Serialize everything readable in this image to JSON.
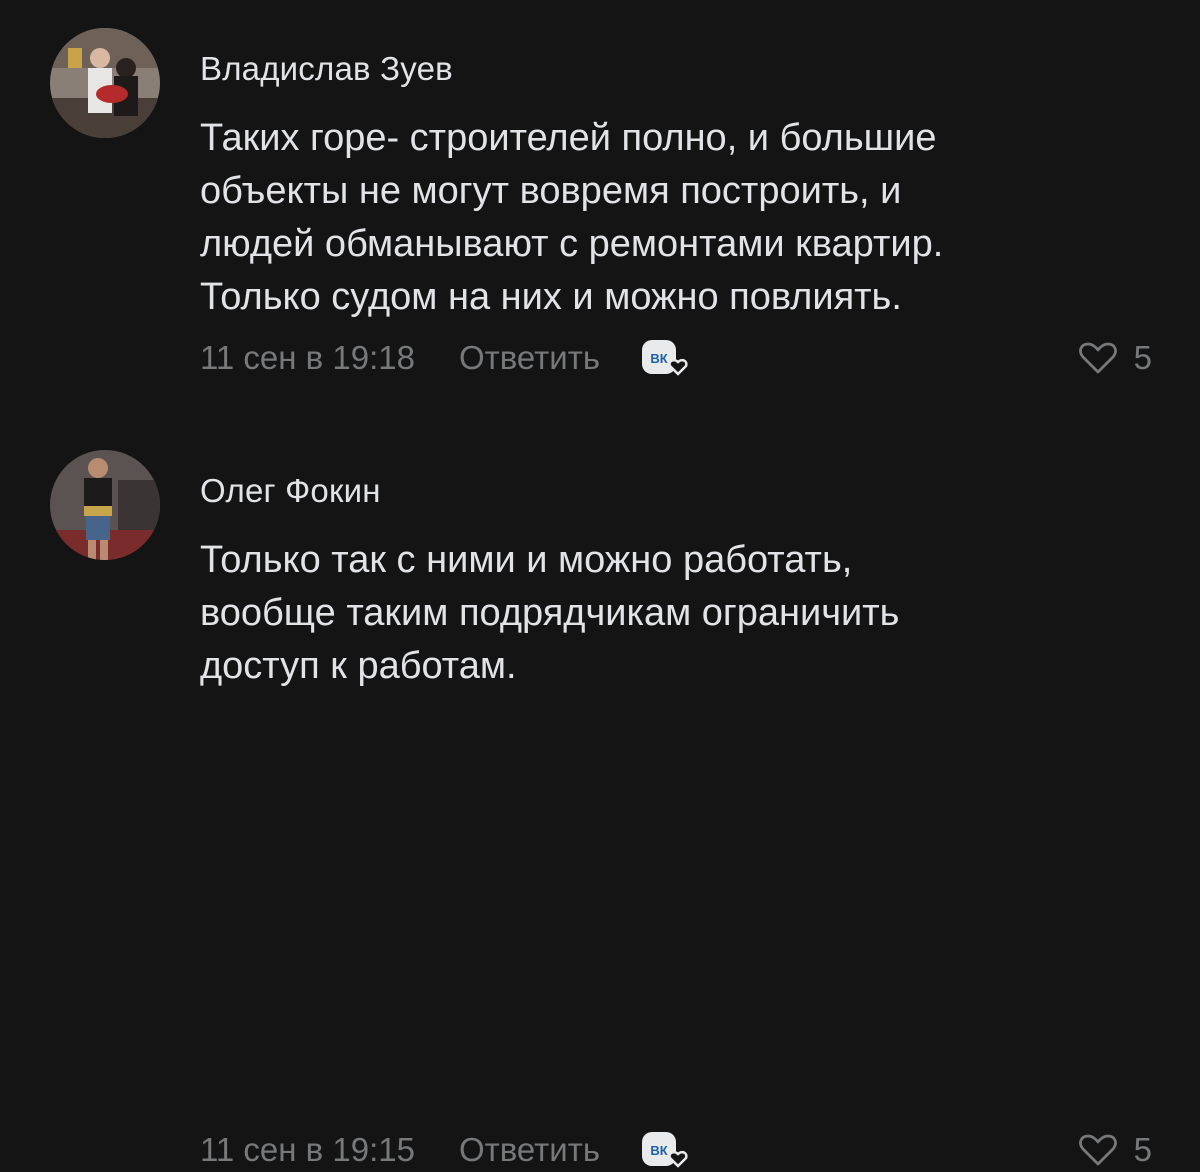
{
  "comments": [
    {
      "author": "Владислав Зуев",
      "text_lines": [
        "Таких горе- строителей полно, и большие",
        "объекты не могут вовремя построить, и",
        "людей обманывают с ремонтами квартир.",
        "Только судом на них и можно повлиять."
      ],
      "time": "11 сен в 19:18",
      "reply_label": "Ответить",
      "reaction_icon": "vk-reaction-icon",
      "likes_icon": "heart-outline-icon",
      "likes": "5"
    },
    {
      "author": "Олег Фокин",
      "text_lines": [
        "Только так с ними и можно работать,",
        "вообще таким подрядчикам ограничить",
        "доступ к работам."
      ],
      "time": "11 сен в 19:15",
      "reply_label": "Ответить",
      "reaction_icon": "vk-reaction-icon",
      "likes_icon": "heart-outline-icon",
      "likes": "5"
    }
  ],
  "colors": {
    "background": "#141414",
    "primary_text": "#e1e3e6",
    "secondary_text": "#76787a"
  }
}
